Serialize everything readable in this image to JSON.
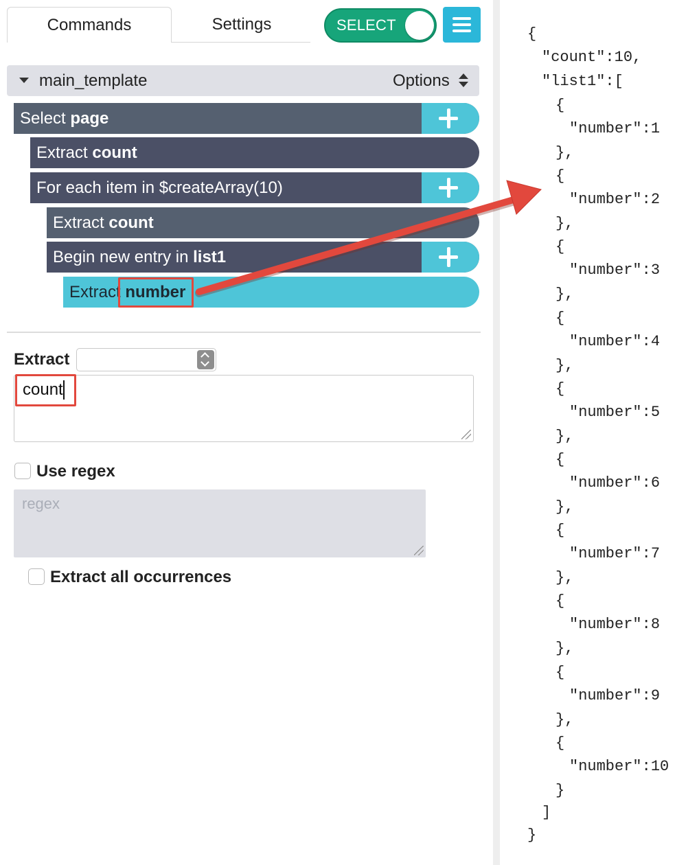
{
  "tabs": {
    "commands": "Commands",
    "settings": "Settings"
  },
  "toggle": {
    "label": "SELECT",
    "on": true
  },
  "template": {
    "name": "main_template",
    "options_label": "Options"
  },
  "commands": [
    {
      "prefix": "Select ",
      "bold": "page"
    },
    {
      "prefix": "Extract ",
      "bold": "count"
    },
    {
      "prefix": "For each item in $createArray(10)",
      "bold": ""
    },
    {
      "prefix": "Extract ",
      "bold": "count"
    },
    {
      "prefix": "Begin new entry in ",
      "bold": "list1"
    },
    {
      "prefix": "Extract ",
      "bold": "number"
    }
  ],
  "editor": {
    "extract_label": "Extract",
    "extract_value": "count",
    "use_regex_label": "Use regex",
    "regex_placeholder": "regex",
    "extract_all_label": "Extract all occurrences"
  },
  "json_output": {
    "open": "{",
    "count_line": "\"count\":10,",
    "list_line": "\"list1\":[",
    "item_open": "{",
    "items": [
      {
        "line": "\"number\":1",
        "close": "},"
      },
      {
        "line": "\"number\":2",
        "close": "},"
      },
      {
        "line": "\"number\":3",
        "close": "},"
      },
      {
        "line": "\"number\":4",
        "close": "},"
      },
      {
        "line": "\"number\":5",
        "close": "},"
      },
      {
        "line": "\"number\":6",
        "close": "},"
      },
      {
        "line": "\"number\":7",
        "close": "},"
      },
      {
        "line": "\"number\":8",
        "close": "},"
      },
      {
        "line": "\"number\":9",
        "close": "},"
      },
      {
        "line": "\"number\":10",
        "close": "}"
      }
    ],
    "list_close": "]",
    "close": "}"
  },
  "colors": {
    "toggle_green": "#17a57a",
    "accent_cyan": "#4ec5d8",
    "command_dark": "#4b5066",
    "command_slate": "#556070",
    "highlight_red": "#e2483d"
  }
}
